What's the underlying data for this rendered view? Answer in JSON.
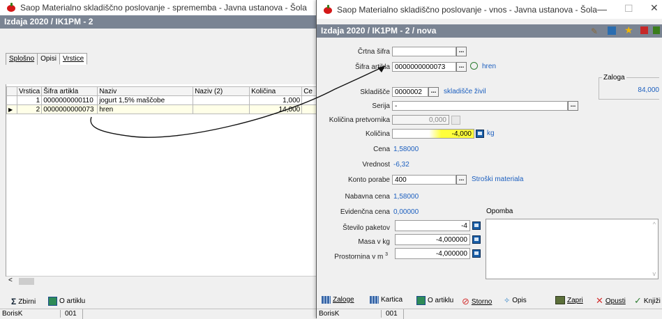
{
  "back": {
    "title": "Saop Materialno skladiščno poslovanje - sprememba - Javna ustanova - Šola",
    "header": "Izdaja 2020 / IK1PM - 2",
    "tabs": [
      "Splošno",
      "Opisi",
      "Vrstice"
    ],
    "columns": [
      "Vrstica",
      "Šifra artikla",
      "Naziv",
      "Naziv (2)",
      "Količina",
      "Ce"
    ],
    "rows": [
      {
        "vrstica": "1",
        "sifra": "0000000000110",
        "naziv": "jogurt 1,5% maščobe",
        "naziv2": "",
        "kolicina": "1,000"
      },
      {
        "vrstica": "2",
        "sifra": "0000000000073",
        "naziv": "hren",
        "naziv2": "",
        "kolicina": "14,000"
      }
    ],
    "toolbar": {
      "zbirni": "Zbirni",
      "o_artiklu": "O artiklu"
    },
    "status": {
      "user": "BorisK",
      "code": "001"
    }
  },
  "front": {
    "title": "Saop Materialno skladiščno poslovanje - vnos - Javna ustanova - Šola",
    "header": "Izdaja 2020 / IK1PM - 2 / nova",
    "labels": {
      "crtna": "Črtna šifra",
      "sifra": "Šifra artikla",
      "skladisce": "Skladišče",
      "serija": "Serija",
      "kol_pretv": "Količina pretvornika",
      "kolicina": "Količina",
      "cena": "Cena",
      "vrednost": "Vrednost",
      "konto": "Konto porabe",
      "nabavna": "Nabavna cena",
      "evidencna": "Evidenčna cena",
      "opomba": "Opomba",
      "paketi": "Število paketov",
      "masa": "Masa v kg",
      "prostornina": "Prostornina v m",
      "prost_sup": "3",
      "zaloga": "Zaloga"
    },
    "values": {
      "crtna": "",
      "sifra": "0000000000073",
      "sifra_naziv": "hren",
      "skladisce": "0000002",
      "skladisce_naziv": "skladišče živil",
      "serija": "-",
      "kol_pretv": "0,000",
      "kolicina": "-4,000",
      "enota": "kg",
      "cena": "1,58000",
      "vrednost": "-6,32",
      "konto": "400",
      "konto_naziv": "Stroški materiala",
      "nabavna": "1,58000",
      "evidencna": "0,00000",
      "paketi": "-4",
      "masa": "-4,000000",
      "prostornina": "-4,000000",
      "zaloga": "84,000"
    },
    "toolbar": [
      "Zaloge",
      "Kartica",
      "O artiklu",
      "Storno",
      "Opis",
      "Zapri",
      "Opusti",
      "Knjiži"
    ],
    "status": {
      "user": "BorisK",
      "code": "001"
    },
    "colors": {
      "header": "#7a8493",
      "highlight": "#ffff3c",
      "link": "#1c5fbf"
    }
  }
}
